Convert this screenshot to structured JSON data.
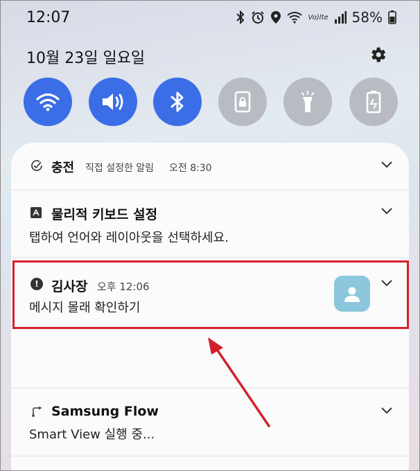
{
  "status_bar": {
    "time": "12:07",
    "network_label": "Vo)lte",
    "battery_percent": "58%"
  },
  "header": {
    "date": "10월 23일 일요일"
  },
  "quick_toggles": [
    {
      "name": "wifi",
      "state": "on"
    },
    {
      "name": "sound",
      "state": "on"
    },
    {
      "name": "bluetooth",
      "state": "on"
    },
    {
      "name": "lock",
      "state": "off"
    },
    {
      "name": "flashlight",
      "state": "off"
    },
    {
      "name": "power-saving",
      "state": "off"
    }
  ],
  "notifications": {
    "charging": {
      "title": "충전",
      "subtitle": "직접 설정한 알림",
      "time": "오전 8:30"
    },
    "keyboard": {
      "title": "물리적 키보드 설정",
      "body": "탭하여 언어와 레이아웃을 선택하세요."
    },
    "message": {
      "sender": "김사장",
      "time": "오후 12:06",
      "body": "메시지 몰래 확인하기"
    },
    "samsung_flow": {
      "title": "Samsung Flow",
      "body": "Smart View 실행 중..."
    }
  },
  "colors": {
    "toggle_on": "#3b6ee6",
    "toggle_off": "#b8bcc2",
    "highlight": "#d4202a",
    "avatar": "#8cc7dd"
  }
}
